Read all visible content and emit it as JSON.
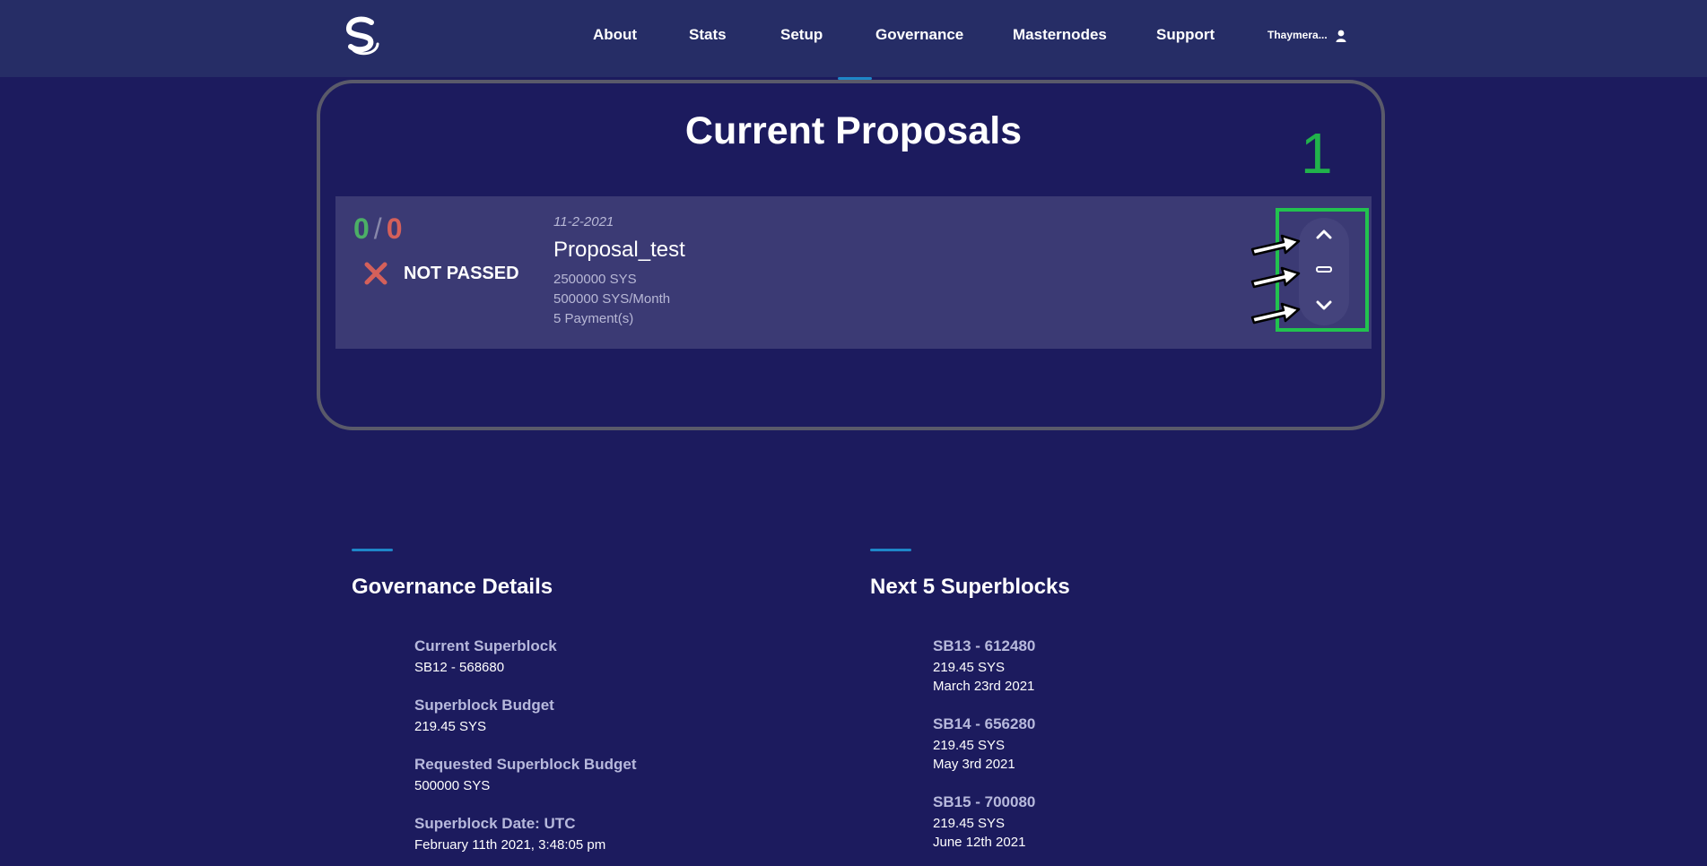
{
  "nav": {
    "items": [
      {
        "label": "About",
        "name": "nav-about"
      },
      {
        "label": "Stats",
        "name": "nav-stats"
      },
      {
        "label": "Setup",
        "name": "nav-setup"
      },
      {
        "label": "Governance",
        "name": "nav-governance"
      },
      {
        "label": "Masternodes",
        "name": "nav-masternodes"
      },
      {
        "label": "Support",
        "name": "nav-support"
      }
    ],
    "user": "Thaymera...",
    "logo_icon": "syscoin-logo-icon",
    "user_icon": "user-icon"
  },
  "proposals": {
    "title": "Current Proposals",
    "annotation_number": "1",
    "items": [
      {
        "votes_yes": "0",
        "votes_separator": "/",
        "votes_no": "0",
        "status": "NOT PASSED",
        "date": "11-2-2021",
        "name": "Proposal_test",
        "total": "2500000 SYS",
        "monthly": "500000 SYS/Month",
        "payments": "5 Payment(s)"
      }
    ],
    "vote_buttons": [
      "vote-up-icon",
      "vote-abstain-icon",
      "vote-down-icon"
    ]
  },
  "governance_details": {
    "title": "Governance Details",
    "items": [
      {
        "label": "Current Superblock",
        "value": "SB12 - 568680"
      },
      {
        "label": "Superblock Budget",
        "value": "219.45 SYS"
      },
      {
        "label": "Requested Superblock Budget",
        "value": "500000 SYS"
      },
      {
        "label": "Superblock Date: UTC",
        "value": "February 11th 2021, 3:48:05 pm"
      }
    ]
  },
  "next_superblocks": {
    "title": "Next 5 Superblocks",
    "items": [
      {
        "label": "SB13 - 612480",
        "budget": "219.45 SYS",
        "date": "March 23rd 2021"
      },
      {
        "label": "SB14 - 656280",
        "budget": "219.45 SYS",
        "date": "May 3rd 2021"
      },
      {
        "label": "SB15 - 700080",
        "budget": "219.45 SYS",
        "date": "June 12th 2021"
      }
    ]
  },
  "colors": {
    "background": "#1c1b5e",
    "navbar": "#262d66",
    "card": "#3b3a74",
    "vote_yes": "#4caf66",
    "vote_no": "#d4605a",
    "annotation": "#22c24f",
    "accent": "#1e86c8"
  }
}
